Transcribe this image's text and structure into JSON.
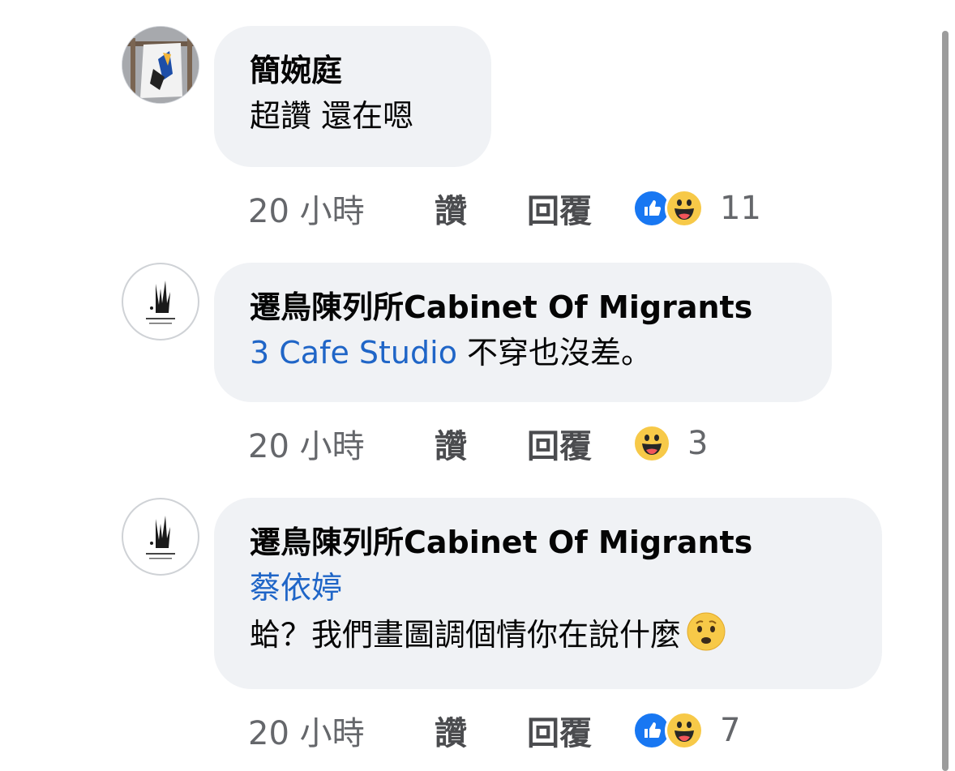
{
  "comments": [
    {
      "author": "簡婉庭",
      "lines": [
        "超讚 還在嗯"
      ],
      "time": "20 小時",
      "like": "讚",
      "reply": "回覆",
      "reactions": [
        "like",
        "haha"
      ],
      "reaction_count": "11"
    },
    {
      "author": "遷鳥陳列所Cabinet Of Migrants",
      "tag": "3 Cafe Studio",
      "text": " 不穿也沒差。",
      "time": "20 小時",
      "like": "讚",
      "reply": "回覆",
      "reactions": [
        "haha"
      ],
      "reaction_count": "3"
    },
    {
      "author": "遷鳥陳列所Cabinet Of Migrants",
      "tag": "蔡依婷",
      "text": "蛤？我們畫圖調個情你在說什麼",
      "time": "20 小時",
      "like": "讚",
      "reply": "回覆",
      "reactions": [
        "like",
        "haha"
      ],
      "reaction_count": "7"
    }
  ],
  "colors": {
    "tag": "#1f65c7",
    "bubble": "#f0f2f5",
    "like": "#1877f2",
    "haha": "#f7c948"
  }
}
